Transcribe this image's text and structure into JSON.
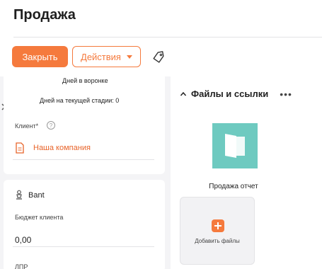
{
  "page": {
    "title": "Продажа"
  },
  "toolbar": {
    "close_label": "Закрыть",
    "actions_label": "Действия",
    "tag_icon": "tag-icon"
  },
  "summary": {
    "days_in_funnel": "Дней в воронке",
    "days_in_stage": "Дней на текущей стадии: 0"
  },
  "client": {
    "label": "Клиент*",
    "help_icon": "?",
    "value": "Наша компания"
  },
  "bant": {
    "title": "Bant",
    "budget_label": "Бюджет клиента",
    "budget_value": "0,00",
    "next_label": "ЛПР"
  },
  "files": {
    "title": "Файлы и ссылки",
    "more": "•••",
    "items": [
      {
        "name": "Продажа отчет"
      }
    ],
    "add_label": "Добавить файлы"
  },
  "colors": {
    "accent": "#f57a3d",
    "link": "#e8642a",
    "thumb": "#6ecac0"
  }
}
